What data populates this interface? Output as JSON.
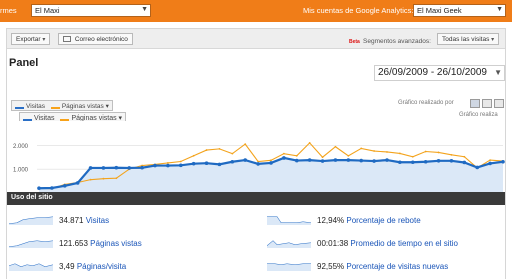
{
  "header": {
    "accounts_label": "rmes",
    "account_select": "El Maxi",
    "profiles_label": "Mis cuentas de Google Analytics:",
    "profile_select": "El Maxi Geek"
  },
  "toolbar": {
    "export_label": "Exportar",
    "email_label": "Correo electrónico",
    "beta_badge": "Beta",
    "segments_label": "Segmentos avanzados:",
    "segment_select": "Todas las visitas"
  },
  "panel": {
    "title": "Panel",
    "date_range": "26/09/2009 - 26/10/2009"
  },
  "chart_controls": {
    "series_1": "Visitas",
    "series_2": "Páginas vistas",
    "chart_by_label": "Gráfico realizado por",
    "chart_by_label_2": "Gráfico realiza"
  },
  "chart_data": {
    "type": "line",
    "ylabel_ticks": [
      "2.000",
      "1.000"
    ],
    "ylim": [
      0,
      2600
    ],
    "series": [
      {
        "name": "Visitas",
        "color": "#1f6ac2",
        "values": [
          200,
          210,
          300,
          420,
          1050,
          1050,
          1060,
          1050,
          1060,
          1150,
          1150,
          1160,
          1230,
          1250,
          1200,
          1310,
          1380,
          1220,
          1260,
          1470,
          1360,
          1380,
          1340,
          1380,
          1380,
          1360,
          1340,
          1380,
          1290,
          1290,
          1310,
          1350,
          1350,
          1280,
          1070,
          1240,
          1310
        ]
      },
      {
        "name": "Páginas vistas",
        "color": "#f3a31c",
        "values": [
          200,
          180,
          360,
          440,
          560,
          600,
          620,
          1000,
          1150,
          1200,
          1260,
          1320,
          1560,
          1800,
          1850,
          1650,
          2050,
          1320,
          1370,
          1650,
          1560,
          2100,
          1500,
          1940,
          1560,
          1870,
          1760,
          1720,
          1660,
          1520,
          1740,
          1700,
          1600,
          1520,
          1050,
          1380,
          1340
        ]
      }
    ]
  },
  "site_usage": {
    "title": "Uso del sitio",
    "metrics": [
      {
        "value": "34.871",
        "label": "Visitas"
      },
      {
        "value": "121.653",
        "label": "Páginas vistas"
      },
      {
        "value": "3,49",
        "label": "Páginas/visita"
      },
      {
        "value": "12,94%",
        "label": "Porcentaje de rebote"
      },
      {
        "value": "00:01:38",
        "label": "Promedio de tiempo en el sitio"
      },
      {
        "value": "92,55%",
        "label": "Porcentaje de visitas nuevas"
      }
    ]
  }
}
